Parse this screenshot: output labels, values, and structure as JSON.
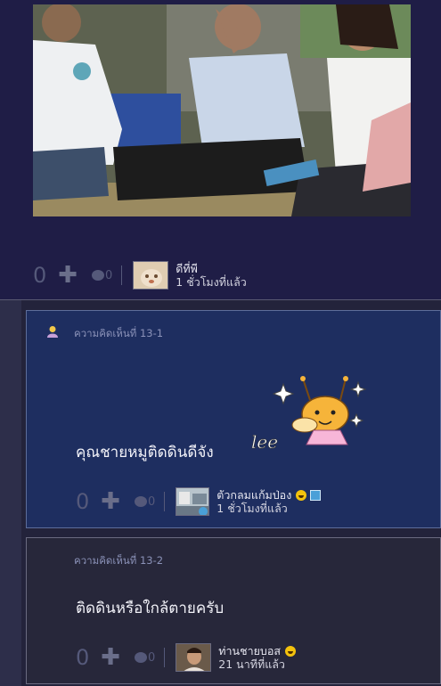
{
  "post": {
    "footer": {
      "like_count": "0",
      "emotion_count": "0",
      "author_name": "ดีที่พี",
      "time_ago": "1 ชั่วโมงที่แล้ว"
    }
  },
  "comments": [
    {
      "label": "ความคิดเห็นที่ 13-1",
      "text": "คุณชายหมูติดดินดีจัง",
      "sticker_text": "lee",
      "like_count": "0",
      "emotion_count": "0",
      "author_name": "ตัวกลมแก้มป่อง",
      "time_ago": "1 ชั่วโมงที่แล้ว"
    },
    {
      "label": "ความคิดเห็นที่ 13-2",
      "text": "ติดดินหรือใกล้ตายครับ",
      "like_count": "0",
      "emotion_count": "0",
      "author_name": "ท่านชายบอส",
      "time_ago": "21 นาทีที่แล้ว"
    }
  ],
  "colors": {
    "top_card_bg": "#1f1d46",
    "comment1_bg": "#1e2e60",
    "comment2_bg": "#27273a",
    "muted_icon": "#55597a"
  },
  "icons": [
    "plus-icon",
    "emotion-icon",
    "member-icon",
    "smiley-emoji-icon",
    "badge-icon"
  ]
}
